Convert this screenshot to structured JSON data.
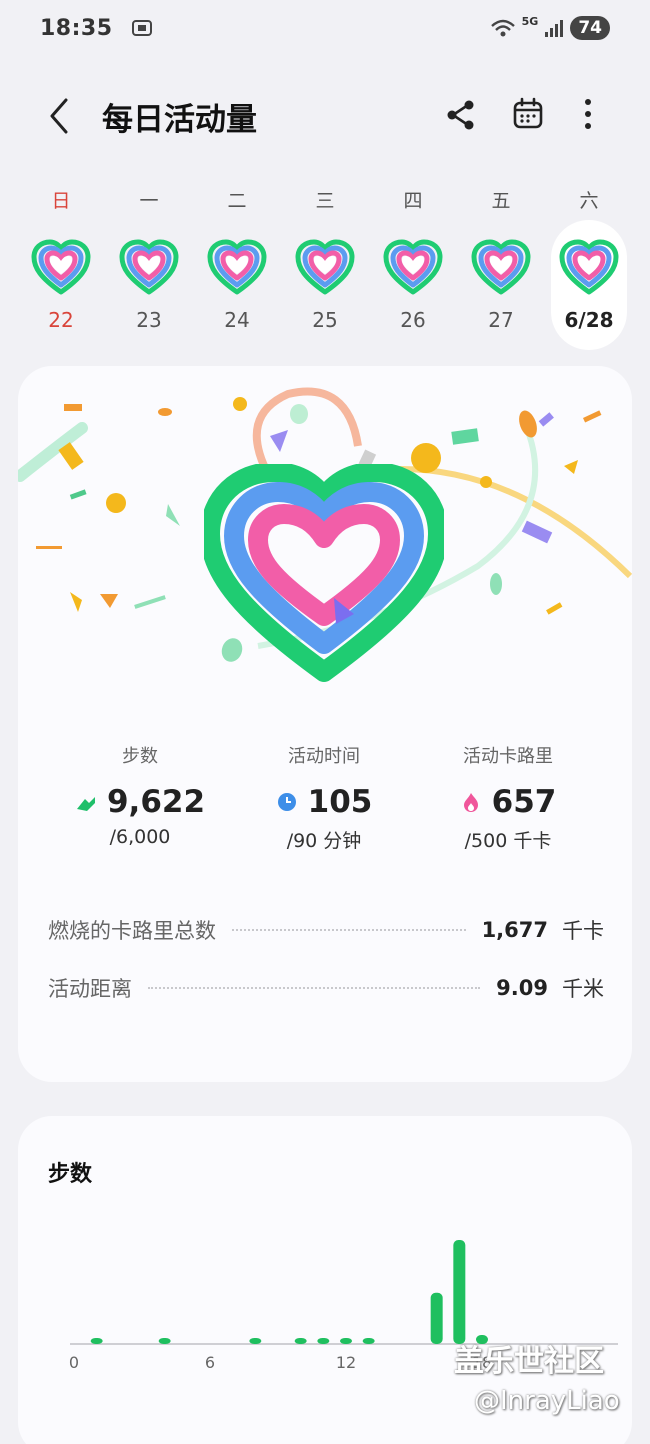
{
  "status": {
    "time": "18:35",
    "network": "5G",
    "battery": "74"
  },
  "header": {
    "title": "每日活动量"
  },
  "week": {
    "weekdays": [
      "日",
      "一",
      "二",
      "三",
      "四",
      "五",
      "六"
    ],
    "dates": [
      "22",
      "23",
      "24",
      "25",
      "26",
      "27",
      "6/28"
    ],
    "selected_index": 6
  },
  "summary": {
    "steps": {
      "label": "步数",
      "value": "9,622",
      "goal": "/6,000"
    },
    "active_time": {
      "label": "活动时间",
      "value": "105",
      "goal": "/90 分钟"
    },
    "active_calories": {
      "label": "活动卡路里",
      "value": "657",
      "goal": "/500 千卡"
    }
  },
  "totals": {
    "calories": {
      "label": "燃烧的卡路里总数",
      "value": "1,677",
      "unit": "千卡"
    },
    "distance": {
      "label": "活动距离",
      "value": "9.09",
      "unit": "千米"
    }
  },
  "steps_chart": {
    "title": "步数"
  },
  "chart_data": {
    "type": "bar",
    "title": "步数",
    "xlabel": "",
    "ylabel": "",
    "x_ticks": [
      "0",
      "6",
      "12",
      "18"
    ],
    "x_range": [
      0,
      24
    ],
    "grid": false,
    "x": [
      1,
      4,
      8,
      10,
      11,
      12,
      13,
      16,
      17,
      18
    ],
    "values": [
      40,
      40,
      40,
      80,
      40,
      40,
      40,
      1600,
      3250,
      280
    ]
  },
  "watermark": {
    "line1": "盖乐世社区",
    "line2": "@InrayLiao"
  },
  "colors": {
    "ring_outer": "#1fcc72",
    "ring_middle": "#5b9cf0",
    "ring_inner": "#f25ea8",
    "bar": "#1fbf5f",
    "sunday": "#d9443a"
  },
  "icons": {
    "back": "chevron-left-icon",
    "share": "share-icon",
    "calendar": "calendar-icon",
    "more": "more-vertical-icon",
    "steps": "shoe-icon",
    "time": "clock-icon",
    "calories": "flame-icon"
  }
}
